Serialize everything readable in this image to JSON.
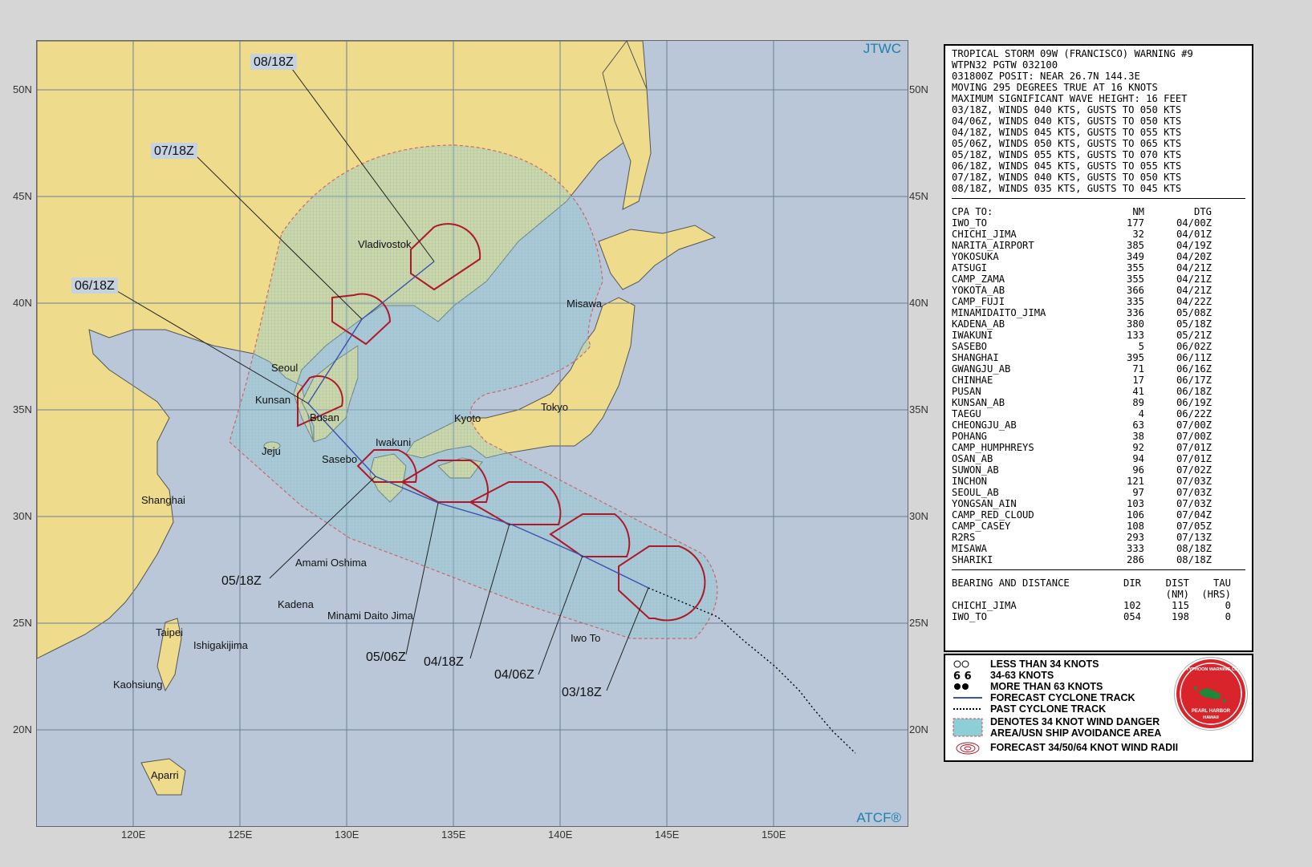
{
  "map": {
    "corner_top": "JTWC",
    "corner_bottom": "ATCF®",
    "lat_labels": [
      "50N",
      "45N",
      "40N",
      "35N",
      "30N",
      "25N",
      "20N"
    ],
    "lon_labels": [
      "120E",
      "125E",
      "130E",
      "135E",
      "140E",
      "145E",
      "150E"
    ],
    "places": [
      "Vladivostok",
      "Misawa",
      "Seoul",
      "Kunsan",
      "Busan",
      "Kyoto",
      "Tokyo",
      "Iwakuni",
      "Jeju",
      "Sasebo",
      "Shanghai",
      "Amami Oshima",
      "Kadena",
      "Minami Daito Jima",
      "Iwo To",
      "Taipei",
      "Ishigakijima",
      "Kaohsiung",
      "Aparri"
    ],
    "forecast_times": [
      "08/18Z",
      "07/18Z",
      "06/18Z",
      "05/18Z",
      "05/06Z",
      "04/18Z",
      "04/06Z",
      "03/18Z"
    ],
    "colors": {
      "land": "#eedc8c",
      "ocean": "#b9c7d8",
      "danger_area": "#8ccfd6",
      "wind_radii": "#b0182a",
      "forecast_track": "#3a52b0"
    }
  },
  "warning": {
    "header": [
      "TROPICAL STORM 09W (FRANCISCO) WARNING #9",
      "WTPN32 PGTW 032100",
      "031800Z POSIT: NEAR 26.7N 144.3E",
      "MOVING 295 DEGREES TRUE AT 16 KNOTS",
      "MAXIMUM SIGNIFICANT WAVE HEIGHT: 16 FEET",
      "03/18Z, WINDS 040 KTS, GUSTS TO 050 KTS",
      "04/06Z, WINDS 040 KTS, GUSTS TO 050 KTS",
      "04/18Z, WINDS 045 KTS, GUSTS TO 055 KTS",
      "05/06Z, WINDS 050 KTS, GUSTS TO 065 KTS",
      "05/18Z, WINDS 055 KTS, GUSTS TO 070 KTS",
      "06/18Z, WINDS 045 KTS, GUSTS TO 055 KTS",
      "07/18Z, WINDS 040 KTS, GUSTS TO 050 KTS",
      "08/18Z, WINDS 035 KTS, GUSTS TO 045 KTS"
    ],
    "cpa_headers": [
      "CPA TO:",
      "NM",
      "DTG"
    ],
    "cpa_rows": [
      [
        "IWO_TO",
        "177",
        "04/00Z"
      ],
      [
        "CHICHI_JIMA",
        "32",
        "04/01Z"
      ],
      [
        "NARITA_AIRPORT",
        "385",
        "04/19Z"
      ],
      [
        "YOKOSUKA",
        "349",
        "04/20Z"
      ],
      [
        "ATSUGI",
        "355",
        "04/21Z"
      ],
      [
        "CAMP_ZAMA",
        "355",
        "04/21Z"
      ],
      [
        "YOKOTA_AB",
        "366",
        "04/21Z"
      ],
      [
        "CAMP_FUJI",
        "335",
        "04/22Z"
      ],
      [
        "MINAMIDAITO_JIMA",
        "336",
        "05/08Z"
      ],
      [
        "KADENA_AB",
        "380",
        "05/18Z"
      ],
      [
        "IWAKUNI",
        "133",
        "05/21Z"
      ],
      [
        "SASEBO",
        "5",
        "06/02Z"
      ],
      [
        "SHANGHAI",
        "395",
        "06/11Z"
      ],
      [
        "GWANGJU_AB",
        "71",
        "06/16Z"
      ],
      [
        "CHINHAE",
        "17",
        "06/17Z"
      ],
      [
        "PUSAN",
        "41",
        "06/18Z"
      ],
      [
        "KUNSAN_AB",
        "89",
        "06/19Z"
      ],
      [
        "TAEGU",
        "4",
        "06/22Z"
      ],
      [
        "CHEONGJU_AB",
        "63",
        "07/00Z"
      ],
      [
        "POHANG",
        "38",
        "07/00Z"
      ],
      [
        "CAMP_HUMPHREYS",
        "92",
        "07/01Z"
      ],
      [
        "OSAN_AB",
        "94",
        "07/01Z"
      ],
      [
        "SUWON_AB",
        "96",
        "07/02Z"
      ],
      [
        "INCHON",
        "121",
        "07/03Z"
      ],
      [
        "SEOUL_AB",
        "97",
        "07/03Z"
      ],
      [
        "YONGSAN_AIN",
        "103",
        "07/03Z"
      ],
      [
        "CAMP_RED_CLOUD",
        "106",
        "07/04Z"
      ],
      [
        "CAMP_CASEY",
        "108",
        "07/05Z"
      ],
      [
        "R2RS",
        "293",
        "07/13Z"
      ],
      [
        "MISAWA",
        "333",
        "08/18Z"
      ],
      [
        "SHARIKI",
        "286",
        "08/18Z"
      ]
    ],
    "bd_headers": [
      "BEARING AND DISTANCE",
      "DIR",
      "DIST",
      "TAU"
    ],
    "bd_subheaders": [
      "(NM)",
      "(HRS)"
    ],
    "bd_rows": [
      [
        "CHICHI_JIMA",
        "102",
        "115",
        "0"
      ],
      [
        "IWO_TO",
        "054",
        "198",
        "0"
      ]
    ]
  },
  "legend": {
    "items": [
      "LESS THAN 34 KNOTS",
      "34-63 KNOTS",
      "MORE THAN 63 KNOTS",
      "FORECAST CYCLONE TRACK",
      "PAST CYCLONE TRACK",
      "DENOTES 34 KNOT WIND DANGER\nAREA/USN SHIP AVOIDANCE AREA",
      "FORECAST 34/50/64 KNOT WIND RADII"
    ],
    "logo_text": [
      "JOINT TYPHOON WARNING CENTER",
      "PEARL HARBOR",
      "HAWAII"
    ]
  }
}
